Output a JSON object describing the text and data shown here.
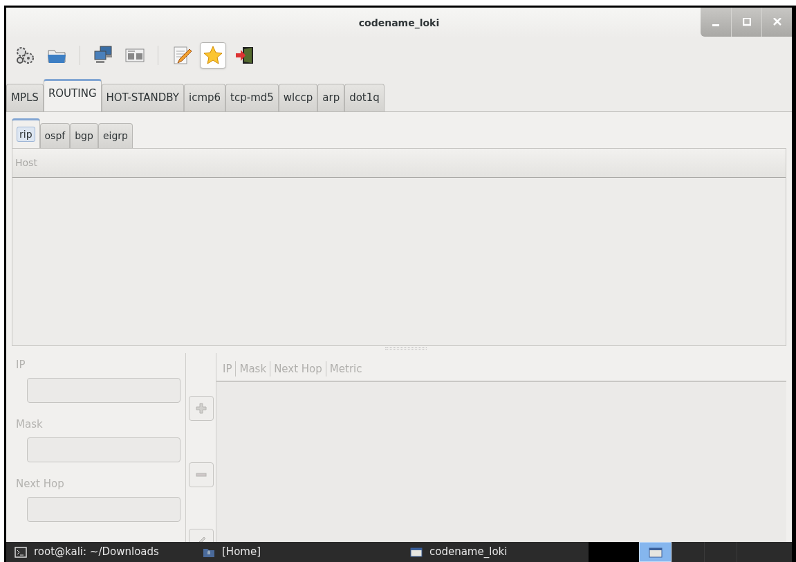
{
  "window": {
    "title": "codename_loki",
    "controls": [
      {
        "kind": "minimize"
      },
      {
        "kind": "maximize"
      },
      {
        "kind": "close"
      }
    ]
  },
  "toolbar": [
    {
      "kind": "gears",
      "pressed": false
    },
    {
      "kind": "folder",
      "pressed": false
    },
    {
      "kind": "separator"
    },
    {
      "kind": "computers",
      "pressed": false
    },
    {
      "kind": "panels",
      "pressed": false
    },
    {
      "kind": "separator"
    },
    {
      "kind": "edit",
      "pressed": false
    },
    {
      "kind": "star",
      "pressed": true
    },
    {
      "kind": "exit",
      "pressed": false
    }
  ],
  "tabs": [
    {
      "label": "MPLS",
      "selected": false
    },
    {
      "label": "ROUTING",
      "selected": true
    },
    {
      "label": "HOT-STANDBY",
      "selected": false
    },
    {
      "label": "icmp6",
      "selected": false
    },
    {
      "label": "tcp-md5",
      "selected": false
    },
    {
      "label": "wlccp",
      "selected": false
    },
    {
      "label": "arp",
      "selected": false
    },
    {
      "label": "dot1q",
      "selected": false
    }
  ],
  "subtabs": [
    {
      "label": "rip",
      "selected": true
    },
    {
      "label": "ospf",
      "selected": false
    },
    {
      "label": "bgp",
      "selected": false
    },
    {
      "label": "eigrp",
      "selected": false
    }
  ],
  "host_table": {
    "columns": [
      "Host"
    ]
  },
  "route_form": {
    "fields": [
      {
        "label": "IP",
        "disabled": true
      },
      {
        "label": "Mask",
        "disabled": true
      },
      {
        "label": "Next Hop",
        "disabled": true
      }
    ],
    "buttons": [
      {
        "kind": "add",
        "disabled": true
      },
      {
        "kind": "remove",
        "disabled": true
      },
      {
        "kind": "edit",
        "disabled": true
      }
    ]
  },
  "route_table": {
    "columns": [
      "IP",
      "Mask",
      "Next Hop",
      "Metric"
    ],
    "disabled": true
  },
  "taskbar": {
    "items": [
      {
        "kind": "terminal",
        "label": "root@kali: ~/Downloads"
      },
      {
        "kind": "folder",
        "label": "[Home]"
      },
      {
        "kind": "window",
        "label": "codename_loki"
      }
    ],
    "workspaces": [
      {
        "selected": true
      },
      {
        "selected": false
      },
      {
        "selected": false
      },
      {
        "selected": false
      }
    ]
  }
}
